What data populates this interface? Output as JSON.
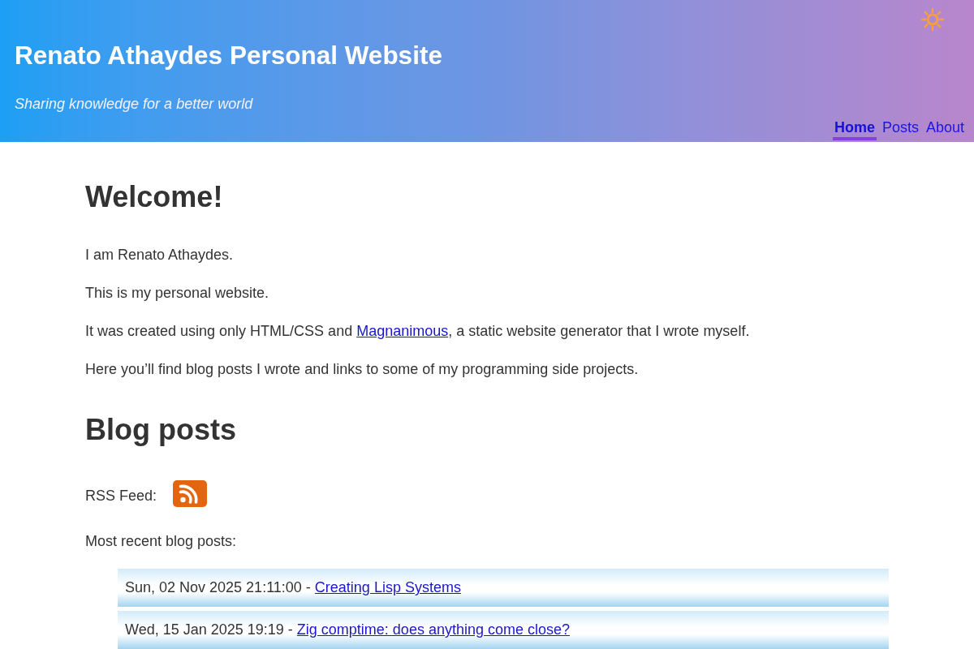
{
  "header": {
    "title": "Renato Athaydes Personal Website",
    "subtitle": "Sharing knowledge for a better world",
    "nav": [
      {
        "label": "Home",
        "selected": true
      },
      {
        "label": "Posts",
        "selected": false
      },
      {
        "label": "About",
        "selected": false
      }
    ]
  },
  "main": {
    "heading": "Welcome!",
    "paragraphs": [
      {
        "text": "I am Renato Athaydes."
      },
      {
        "text": "This is my personal website."
      },
      {
        "text": "It was created using only HTML/CSS and ",
        "link": "Magnanimous",
        "text_after": ", a static website generator that I wrote myself."
      },
      {
        "text": "Here you’ll find blog posts I wrote and links to some of my programming side projects."
      }
    ]
  },
  "blog": {
    "heading": "Blog posts",
    "rss_label": "RSS Feed:",
    "recent_label": "Most recent blog posts:",
    "posts": [
      {
        "date": "Sun, 02 Nov 2025 21:11:00",
        "separator": "-",
        "title": "Creating Lisp Systems"
      },
      {
        "date": "Wed, 15 Jan 2025 19:19",
        "separator": "-",
        "title": "Zig comptime: does anything come close?"
      }
    ]
  }
}
